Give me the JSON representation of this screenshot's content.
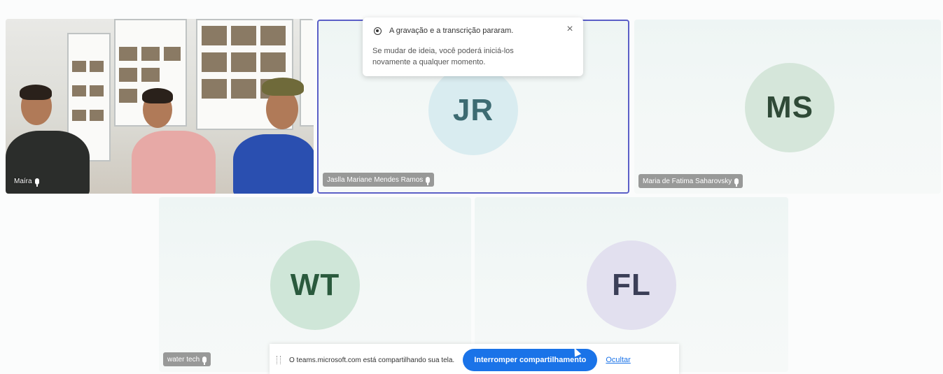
{
  "participants": [
    {
      "id": "maira",
      "name": "Maíra",
      "type": "video"
    },
    {
      "id": "jr",
      "initials": "JR",
      "name": "Jaslla Mariane Mendes Ramos",
      "type": "avatar",
      "avatar_bg": "#d9ecf0",
      "initials_color": "#3d6b72"
    },
    {
      "id": "ms",
      "initials": "MS",
      "name": "Maria de Fatima Saharovsky",
      "type": "avatar",
      "avatar_bg": "#d5e6da",
      "initials_color": "#2f4a37"
    },
    {
      "id": "wt",
      "initials": "WT",
      "name": "water tech",
      "type": "avatar",
      "avatar_bg": "#cfe6d8",
      "initials_color": "#2a5a3d"
    },
    {
      "id": "fl",
      "initials": "FL",
      "name": "",
      "type": "avatar",
      "avatar_bg": "#e2e0ef",
      "initials_color": "#3b3f57"
    }
  ],
  "notice": {
    "title": "A gravação e a transcrição pararam.",
    "body": "Se mudar de ideia, você poderá iniciá-los novamente a qualquer momento."
  },
  "share_bar": {
    "text": "O teams.microsoft.com está compartilhando sua tela.",
    "stop_label": "Interromper compartilhamento",
    "hide_label": "Ocultar"
  },
  "colors": {
    "accent": "#5b5fc7",
    "share_button": "#1a73e8"
  }
}
